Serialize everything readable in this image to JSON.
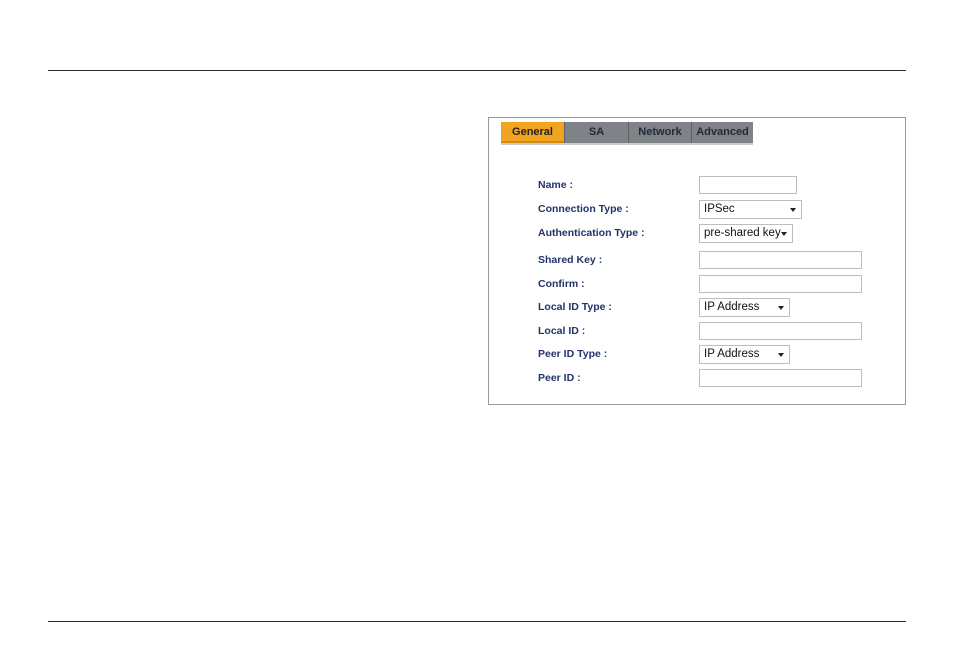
{
  "tabs": [
    {
      "label": "General",
      "active": true
    },
    {
      "label": "SA",
      "active": false
    },
    {
      "label": "Network",
      "active": false
    },
    {
      "label": "Advanced",
      "active": false
    }
  ],
  "form": {
    "name": {
      "label": "Name :",
      "value": ""
    },
    "connection_type": {
      "label": "Connection Type :",
      "value": "IPSec"
    },
    "authentication_type": {
      "label": "Authentication Type :",
      "value": "pre-shared key"
    },
    "shared_key": {
      "label": "Shared Key :",
      "value": ""
    },
    "confirm": {
      "label": "Confirm :",
      "value": ""
    },
    "local_id_type": {
      "label": "Local ID Type :",
      "value": "IP Address"
    },
    "local_id": {
      "label": "Local ID :",
      "value": ""
    },
    "peer_id_type": {
      "label": "Peer ID Type :",
      "value": "IP Address"
    },
    "peer_id": {
      "label": "Peer ID :",
      "value": ""
    }
  },
  "colors": {
    "active_tab": "#f0a41f",
    "inactive_tab": "#7f8286",
    "label_text": "#20336b"
  }
}
